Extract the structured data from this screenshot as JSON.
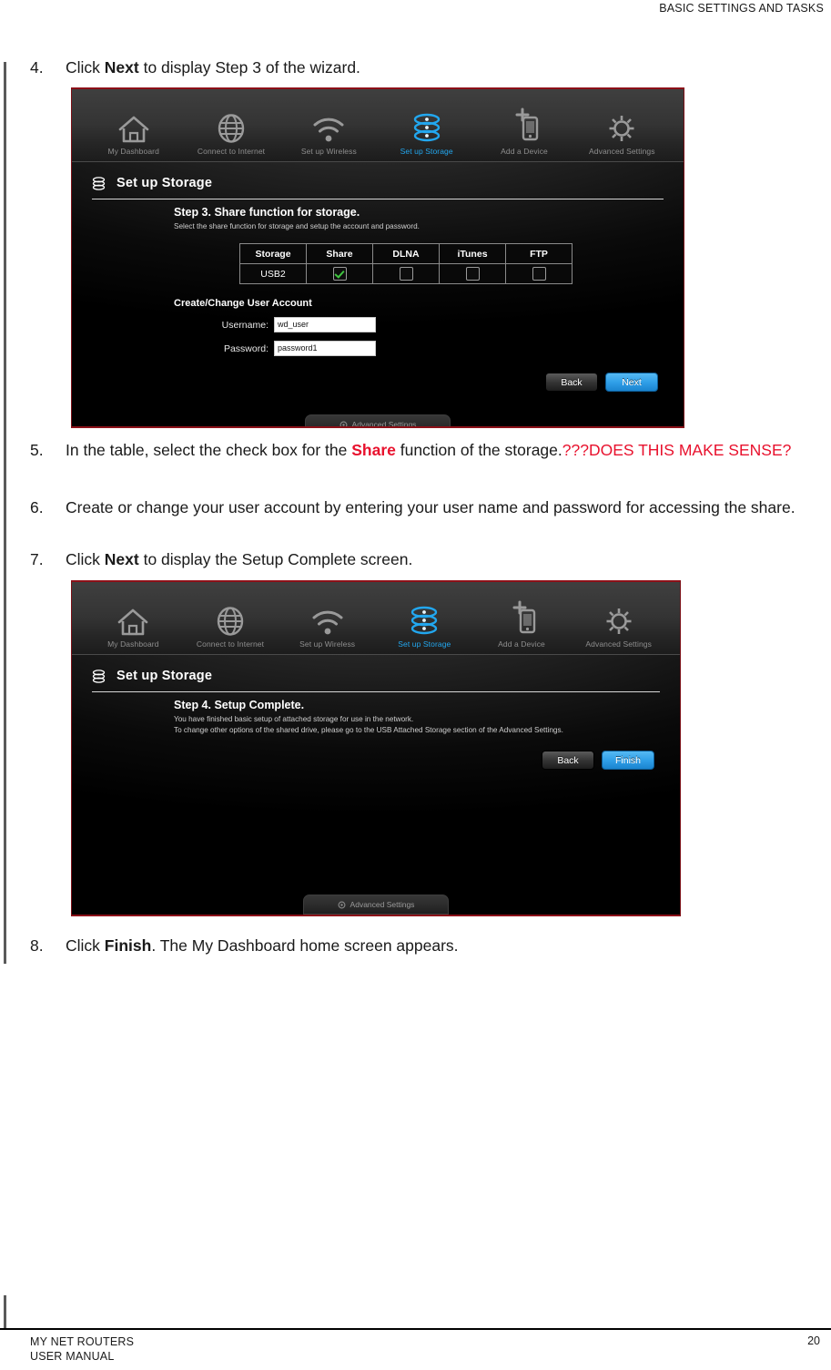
{
  "page": {
    "running_header": "BASIC SETTINGS AND TASKS",
    "footer_line1": "MY NET ROUTERS",
    "footer_line2": "USER MANUAL",
    "page_number": "20"
  },
  "steps": [
    {
      "number": "4.",
      "pre": "Click ",
      "bold": "Next",
      "post": " to display Step 3 of the wizard."
    },
    {
      "number": "5.",
      "pre": "In the table, select the check box for the ",
      "bold_red": "Share",
      "post": " function of the storage.",
      "note": "???DOES THIS MAKE SENSE?"
    },
    {
      "number": "6.",
      "text": "Create or change your user account by entering your user name and password for accessing the share."
    },
    {
      "number": "7.",
      "pre": "Click ",
      "bold": "Next",
      "post": " to display the Setup Complete screen."
    },
    {
      "number": "8.",
      "pre": "Click ",
      "bold": "Finish",
      "post": ". The My Dashboard home screen appears."
    }
  ],
  "nav": {
    "items": [
      {
        "label": "My Dashboard",
        "icon": "home-icon",
        "active": false
      },
      {
        "label": "Connect to Internet",
        "icon": "globe-icon",
        "active": false
      },
      {
        "label": "Set up Wireless",
        "icon": "wifi-icon",
        "active": false
      },
      {
        "label": "Set up Storage",
        "icon": "storage-stack-icon",
        "active": true
      },
      {
        "label": "Add a Device",
        "icon": "add-device-icon",
        "active": false
      },
      {
        "label": "Advanced Settings",
        "icon": "gear-icon",
        "active": false
      }
    ],
    "active_color": "#22a7ef",
    "inactive_color": "#8e8e8e"
  },
  "screenshot_step3": {
    "section_title": "Set up Storage",
    "section_icon": "storage-stack-icon",
    "step_title": "Step 3. Share function for storage.",
    "step_subtitle": "Select the share function for storage and setup the account and password.",
    "table": {
      "headers": [
        "Storage",
        "Share",
        "DLNA",
        "iTunes",
        "FTP"
      ],
      "rows": [
        {
          "storage": "USB2",
          "share": true,
          "dlna": false,
          "itunes": false,
          "ftp": false
        }
      ]
    },
    "account": {
      "title": "Create/Change User Account",
      "username_label": "Username:",
      "username_value": "wd_user",
      "password_label": "Password:",
      "password_value": "password1"
    },
    "buttons": {
      "back": "Back",
      "next": "Next"
    },
    "advanced_tab": "Advanced Settings"
  },
  "screenshot_step4": {
    "section_title": "Set up Storage",
    "section_icon": "storage-stack-icon",
    "step_title": "Step 4. Setup Complete.",
    "step_subtitle_line1": "You have finished basic setup of attached storage for use in the network.",
    "step_subtitle_line2": "To change other options of the shared drive, please go to the USB Attached Storage section of the Advanced Settings.",
    "buttons": {
      "back": "Back",
      "finish": "Finish"
    },
    "advanced_tab": "Advanced Settings"
  },
  "colors": {
    "accent_blue": "#22a7ef",
    "editorial_red": "#e8112d",
    "frame_red": "#8c1018",
    "check_green": "#3fc53f"
  }
}
